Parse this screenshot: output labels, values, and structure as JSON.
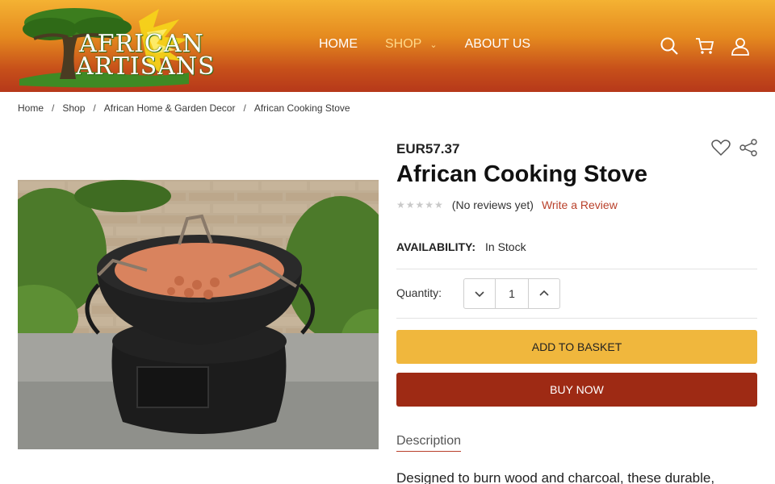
{
  "header": {
    "logo_line1": "AFRICAN",
    "logo_line2": "ARTISANS",
    "nav": [
      {
        "label": "HOME"
      },
      {
        "label": "SHOP"
      },
      {
        "label": "ABOUT US"
      }
    ]
  },
  "breadcrumb": [
    "Home",
    "Shop",
    "African Home & Garden Decor",
    "African Cooking Stove"
  ],
  "product": {
    "price": "EUR57.37",
    "title": "African Cooking Stove",
    "rating_stars": "★★★★★",
    "review_count": "(No reviews yet)",
    "write_review": "Write a Review",
    "availability_label": "AVAILABILITY:",
    "availability_value": "In Stock",
    "quantity_label": "Quantity:",
    "quantity_value": "1",
    "add_to_basket": "ADD TO BASKET",
    "buy_now": "BUY NOW",
    "description_tab": "Description",
    "description_text": "Designed to burn wood and charcoal, these durable,"
  },
  "colors": {
    "basket_button": "#f0b73d",
    "buy_button": "#9e2a14",
    "link": "#b9402a",
    "nav_active": "#ffd98a"
  }
}
